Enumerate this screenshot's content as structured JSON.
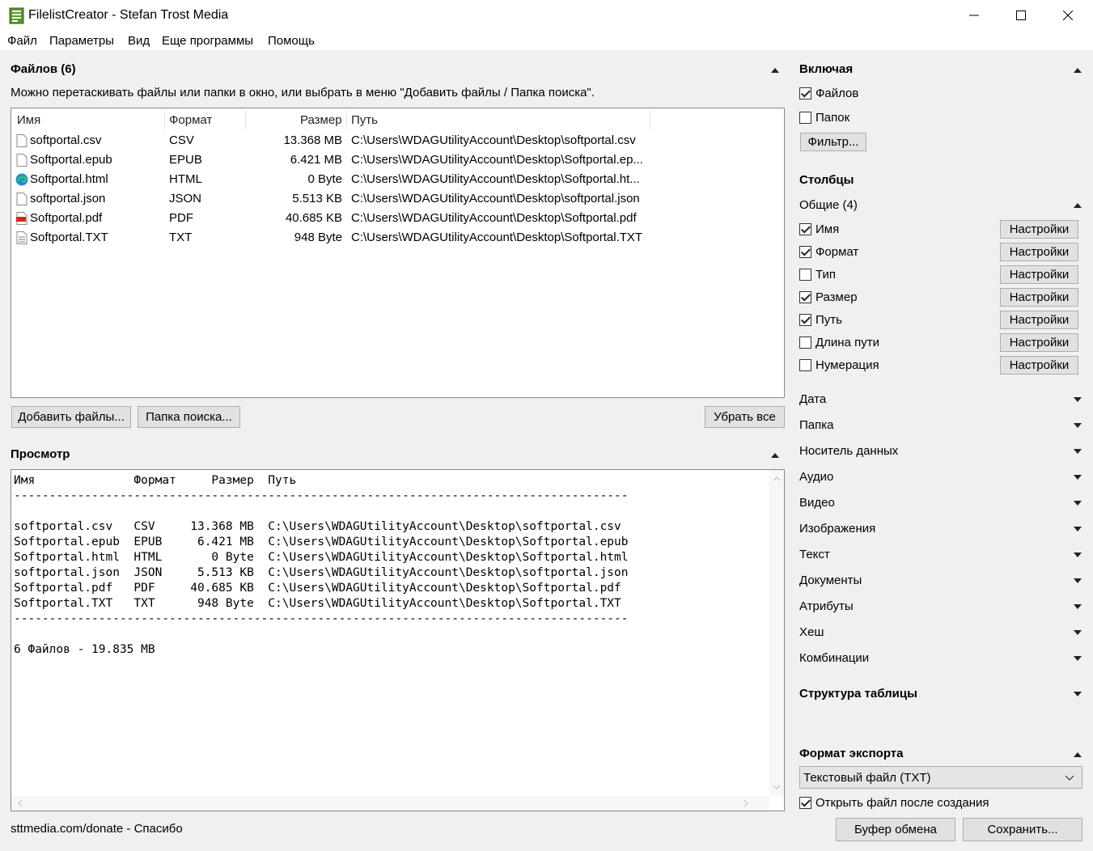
{
  "window": {
    "title": "FilelistCreator - Stefan Trost Media"
  },
  "menu": [
    "Файл",
    "Параметры",
    "Вид",
    "Еще программы",
    "Помощь"
  ],
  "files": {
    "heading": "Файлов (6)",
    "hint": "Можно перетаскивать файлы или папки в окно, или выбрать в меню \"Добавить файлы / Папка поиска\".",
    "columns": [
      "Имя",
      "Формат",
      "Размер",
      "Путь"
    ],
    "rows": [
      {
        "icon": "file-icon",
        "name": "softportal.csv",
        "format": "CSV",
        "size": "13.368 MB",
        "path": "C:\\Users\\WDAGUtilityAccount\\Desktop\\softportal.csv"
      },
      {
        "icon": "file-icon",
        "name": "Softportal.epub",
        "format": "EPUB",
        "size": "6.421 MB",
        "path": "C:\\Users\\WDAGUtilityAccount\\Desktop\\Softportal.ep..."
      },
      {
        "icon": "edge-browser-icon",
        "name": "Softportal.html",
        "format": "HTML",
        "size": "0 Byte",
        "path": "C:\\Users\\WDAGUtilityAccount\\Desktop\\Softportal.ht..."
      },
      {
        "icon": "file-icon",
        "name": "softportal.json",
        "format": "JSON",
        "size": "5.513 KB",
        "path": "C:\\Users\\WDAGUtilityAccount\\Desktop\\softportal.json"
      },
      {
        "icon": "pdf-icon",
        "name": "Softportal.pdf",
        "format": "PDF",
        "size": "40.685 KB",
        "path": "C:\\Users\\WDAGUtilityAccount\\Desktop\\Softportal.pdf"
      },
      {
        "icon": "text-file-icon",
        "name": "Softportal.TXT",
        "format": "TXT",
        "size": "948 Byte",
        "path": "C:\\Users\\WDAGUtilityAccount\\Desktop\\Softportal.TXT"
      }
    ],
    "add_files_label": "Добавить файлы...",
    "search_folder_label": "Папка поиска...",
    "remove_all_label": "Убрать все"
  },
  "preview": {
    "heading": "Просмотр",
    "text": "Имя              Формат     Размер  Путь\n---------------------------------------------------------------------------------------\n\nsoftportal.csv   CSV     13.368 MB  C:\\Users\\WDAGUtilityAccount\\Desktop\\softportal.csv\nSoftportal.epub  EPUB     6.421 MB  C:\\Users\\WDAGUtilityAccount\\Desktop\\Softportal.epub\nSoftportal.html  HTML       0 Byte  C:\\Users\\WDAGUtilityAccount\\Desktop\\Softportal.html\nsoftportal.json  JSON     5.513 KB  C:\\Users\\WDAGUtilityAccount\\Desktop\\softportal.json\nSoftportal.pdf   PDF     40.685 KB  C:\\Users\\WDAGUtilityAccount\\Desktop\\Softportal.pdf\nSoftportal.TXT   TXT      948 Byte  C:\\Users\\WDAGUtilityAccount\\Desktop\\Softportal.TXT\n---------------------------------------------------------------------------------------\n\n6 Файлов - 19.835 MB"
  },
  "status": "sttmedia.com/donate - Спасибо",
  "include": {
    "heading": "Включая",
    "files_label": "Файлов",
    "files_checked": true,
    "folders_label": "Папок",
    "folders_checked": false,
    "filter_label": "Фильтр..."
  },
  "columns_panel": {
    "heading": "Столбцы",
    "general_label": "Общие (4)",
    "settings_label": "Настройки",
    "items": [
      {
        "label": "Имя",
        "checked": true
      },
      {
        "label": "Формат",
        "checked": true
      },
      {
        "label": "Тип",
        "checked": false
      },
      {
        "label": "Размер",
        "checked": true
      },
      {
        "label": "Путь",
        "checked": true
      },
      {
        "label": "Длина пути",
        "checked": false
      },
      {
        "label": "Нумерация",
        "checked": false
      }
    ],
    "groups": [
      "Дата",
      "Папка",
      "Носитель данных",
      "Аудио",
      "Видео",
      "Изображения",
      "Текст",
      "Документы",
      "Атрибуты",
      "Хеш",
      "Комбинации"
    ]
  },
  "table_structure": {
    "heading": "Структура таблицы"
  },
  "export": {
    "heading": "Формат экспорта",
    "format_value": "Текстовый файл (TXT)",
    "open_after_label": "Открыть файл после создания",
    "open_after_checked": true,
    "clipboard_label": "Буфер обмена",
    "save_label": "Сохранить..."
  }
}
